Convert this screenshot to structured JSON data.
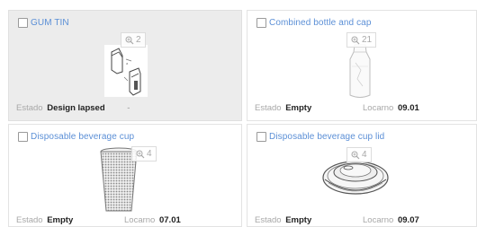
{
  "cards": [
    {
      "title": "GUM TIN",
      "zoom_count": "2",
      "status_label": "Estado",
      "status_value": "Design lapsed",
      "locarno_text": "-",
      "image_icon": "gum-tin-drawing"
    },
    {
      "title": "Combined bottle and cap",
      "zoom_count": "21",
      "status_label": "Estado",
      "status_value": "Empty",
      "locarno_label": "Locarno",
      "locarno_value": "09.01",
      "image_icon": "bottle-with-cap-drawing"
    },
    {
      "title": "Disposable beverage cup",
      "zoom_count": "4",
      "status_label": "Estado",
      "status_value": "Empty",
      "locarno_label": "Locarno",
      "locarno_value": "07.01",
      "image_icon": "beverage-cup-drawing"
    },
    {
      "title": "Disposable beverage cup lid",
      "zoom_count": "4",
      "status_label": "Estado",
      "status_value": "Empty",
      "locarno_label": "Locarno",
      "locarno_value": "09.07",
      "image_icon": "cup-lid-drawing"
    }
  ],
  "colors": {
    "title": "#5b8fd6",
    "muted": "#a8a8a8",
    "lapsed_background": "#ececec"
  }
}
